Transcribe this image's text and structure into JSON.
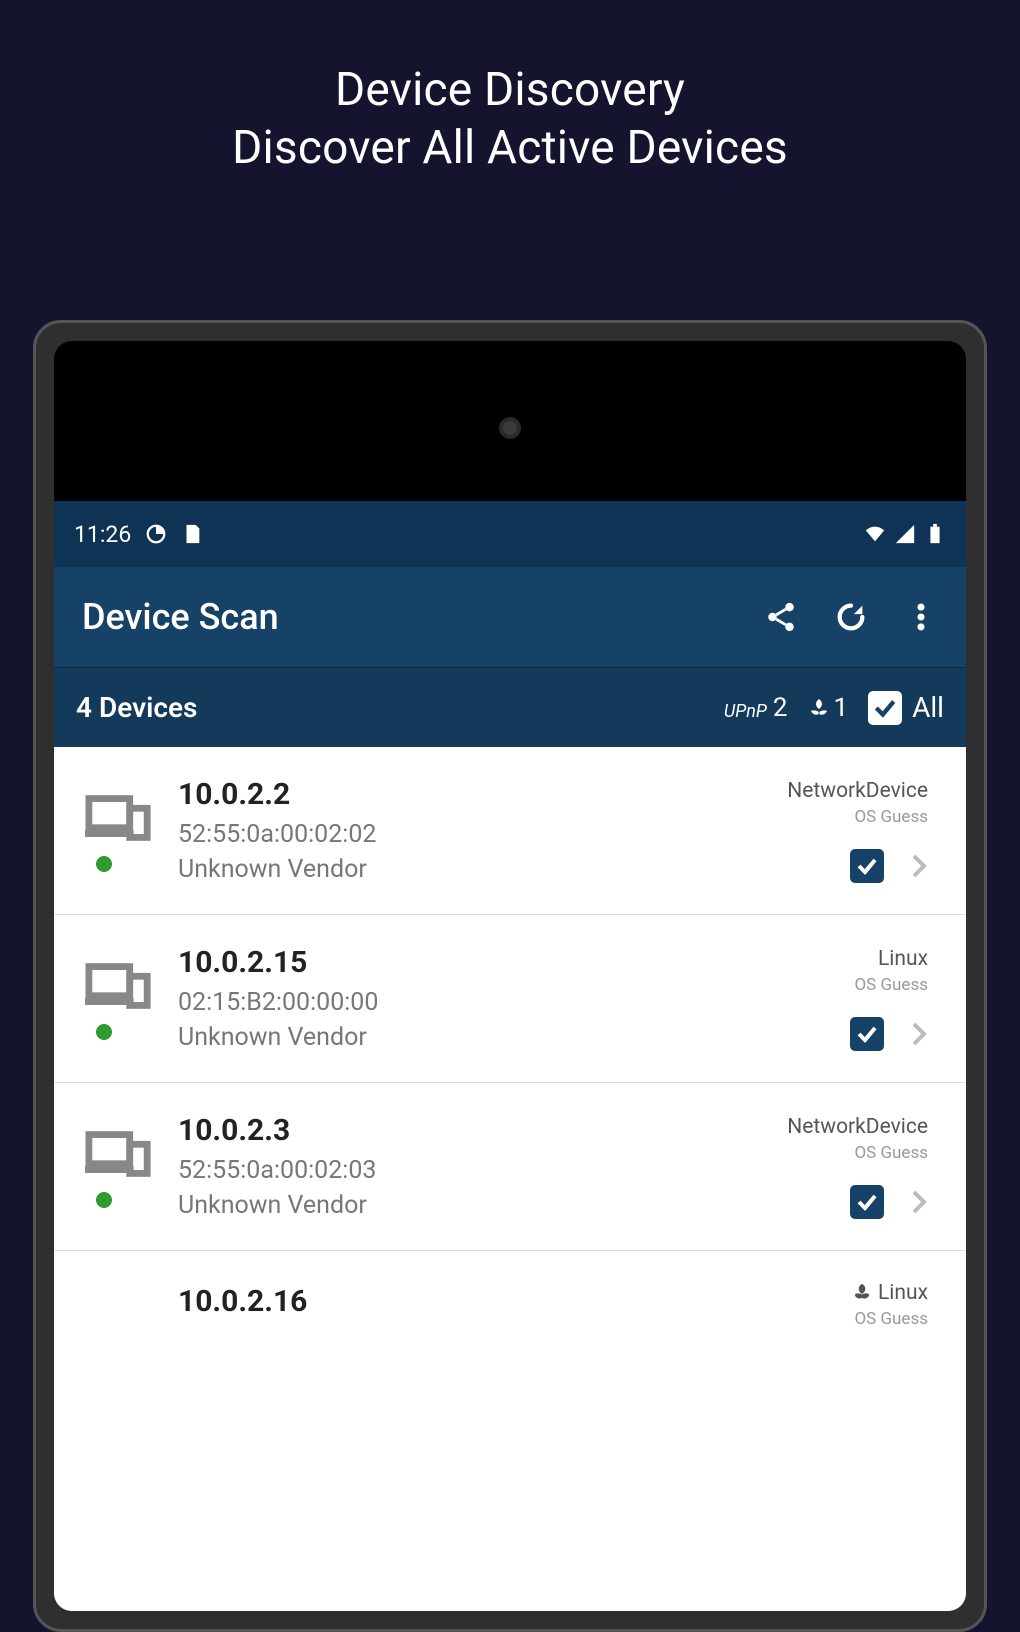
{
  "promo": {
    "line1": "Device Discovery",
    "line2": "Discover All Active Devices"
  },
  "status_bar": {
    "time": "11:26"
  },
  "app_bar": {
    "title": "Device Scan"
  },
  "summary": {
    "title": "4 Devices",
    "upnp_label": "UPnP",
    "upnp_count": "2",
    "bonjour_count": "1",
    "all_label": "All"
  },
  "os_guess_label": "OS Guess",
  "devices": [
    {
      "ip": "10.0.2.2",
      "mac": "52:55:0a:00:02:02",
      "vendor": "Unknown Vendor",
      "os": "NetworkDevice",
      "checked": true
    },
    {
      "ip": "10.0.2.15",
      "mac": "02:15:B2:00:00:00",
      "vendor": "Unknown Vendor",
      "os": "Linux",
      "checked": true
    },
    {
      "ip": "10.0.2.3",
      "mac": "52:55:0a:00:02:03",
      "vendor": "Unknown Vendor",
      "os": "NetworkDevice",
      "checked": true
    },
    {
      "ip": "10.0.2.16",
      "mac": "",
      "vendor": "",
      "os": "Linux",
      "checked": true
    }
  ]
}
